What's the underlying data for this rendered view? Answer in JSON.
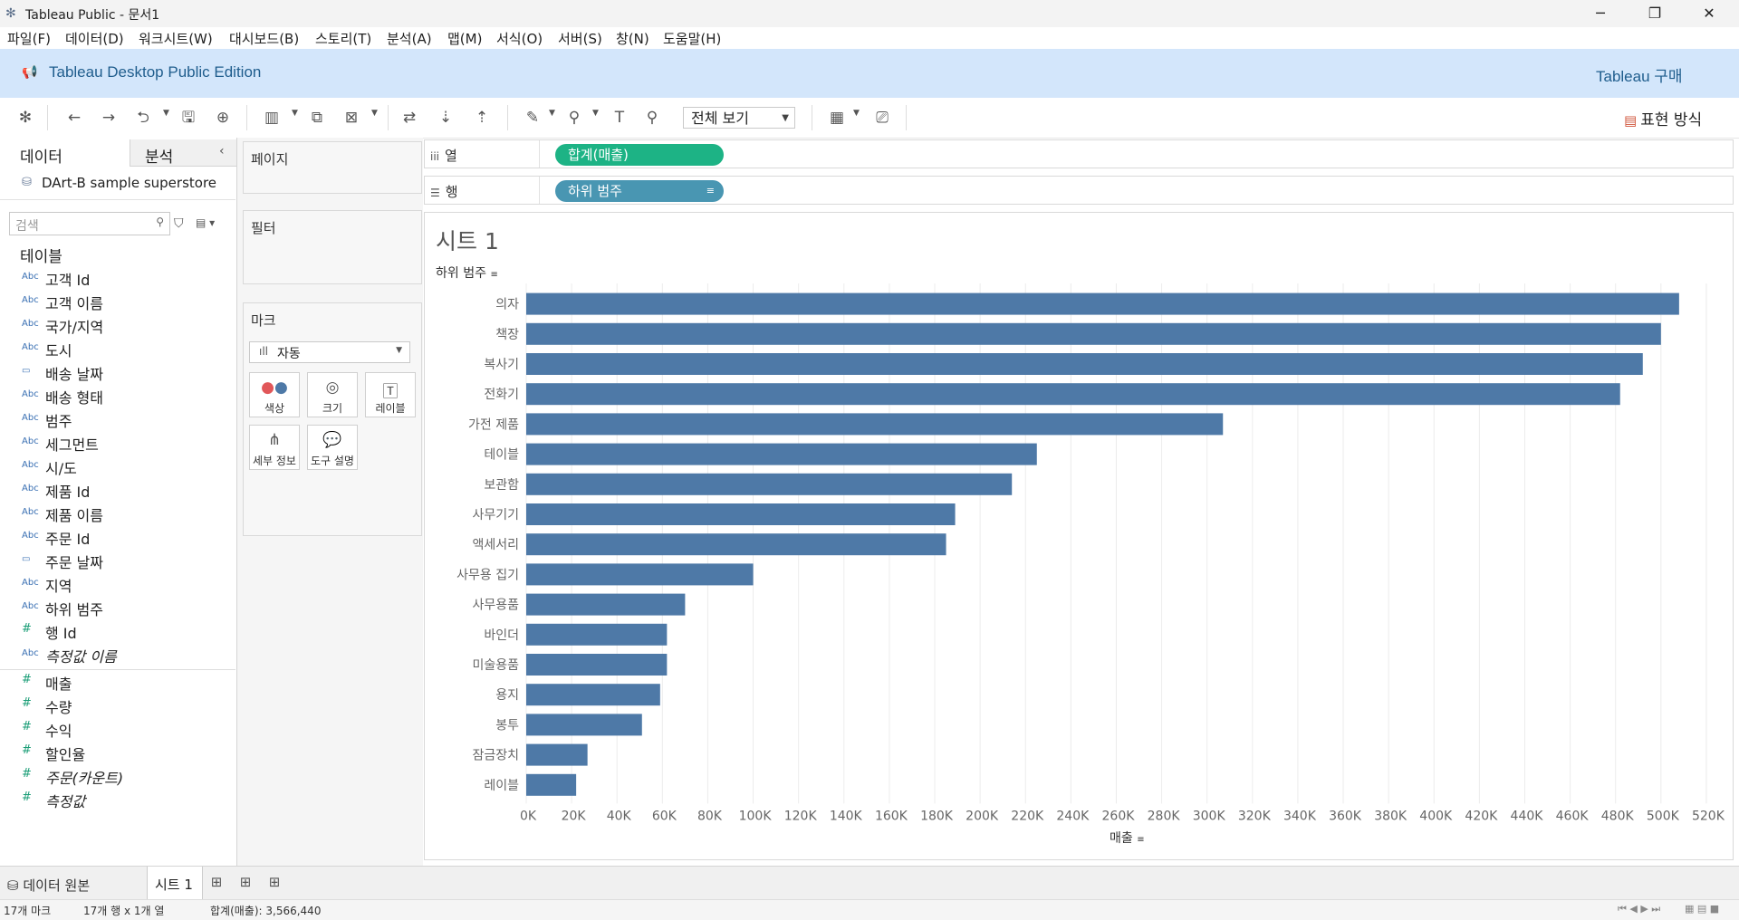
{
  "window": {
    "title": "Tableau Public - 문서1",
    "minimize": "─",
    "restore": "❐",
    "close": "✕"
  },
  "menu": [
    "파일(F)",
    "데이터(D)",
    "워크시트(W)",
    "대시보드(B)",
    "스토리(T)",
    "분석(A)",
    "맵(M)",
    "서식(O)",
    "서버(S)",
    "창(N)",
    "도움말(H)"
  ],
  "edition": {
    "name": "Tableau Desktop Public Edition",
    "buy": "Tableau 구매"
  },
  "toolbar": {
    "fit": "전체 보기",
    "show_me": "표현 방식"
  },
  "data_pane": {
    "tab_data": "데이터",
    "tab_analysis": "분석",
    "datasource": "DArt-B sample superstore",
    "search_placeholder": "검색",
    "tables_heading": "테이블",
    "dimensions": [
      {
        "type": "Abc",
        "name": "고객 Id"
      },
      {
        "type": "Abc",
        "name": "고객 이름"
      },
      {
        "type": "Abc",
        "name": "국가/지역"
      },
      {
        "type": "Abc",
        "name": "도시"
      },
      {
        "type": "date",
        "name": "배송 날짜"
      },
      {
        "type": "Abc",
        "name": "배송 형태"
      },
      {
        "type": "Abc",
        "name": "범주"
      },
      {
        "type": "Abc",
        "name": "세그먼트"
      },
      {
        "type": "Abc",
        "name": "시/도"
      },
      {
        "type": "Abc",
        "name": "제품 Id"
      },
      {
        "type": "Abc",
        "name": "제품 이름"
      },
      {
        "type": "Abc",
        "name": "주문 Id"
      },
      {
        "type": "date",
        "name": "주문 날짜"
      },
      {
        "type": "Abc",
        "name": "지역"
      },
      {
        "type": "Abc",
        "name": "하위 범주"
      },
      {
        "type": "#",
        "name": "행 Id"
      },
      {
        "type": "Abc",
        "name": "측정값 이름",
        "italic": true
      }
    ],
    "measures": [
      {
        "type": "#",
        "name": "매출"
      },
      {
        "type": "#",
        "name": "수량"
      },
      {
        "type": "#",
        "name": "수익"
      },
      {
        "type": "#",
        "name": "할인율"
      },
      {
        "type": "#",
        "name": "주문(카운트)",
        "italic": true
      },
      {
        "type": "#",
        "name": "측정값",
        "italic": true
      }
    ]
  },
  "cards": {
    "pages": "페이지",
    "filters": "필터",
    "marks": "마크",
    "marks_type": "자동",
    "buttons": [
      {
        "icon": "color",
        "label": "색상"
      },
      {
        "icon": "size",
        "label": "크기"
      },
      {
        "icon": "label",
        "label": "레이블"
      },
      {
        "icon": "detail",
        "label": "세부 정보"
      },
      {
        "icon": "tooltip",
        "label": "도구 설명"
      }
    ]
  },
  "shelves": {
    "columns_label": "열",
    "rows_label": "행",
    "columns_pill": "합계(매출)",
    "rows_pill": "하위 범주"
  },
  "sheet": {
    "title": "시트 1",
    "row_header": "하위 범주",
    "x_axis_title": "매출"
  },
  "chart_data": {
    "type": "bar",
    "orientation": "horizontal",
    "categories": [
      "의자",
      "책장",
      "복사기",
      "전화기",
      "가전 제품",
      "테이블",
      "보관함",
      "사무기기",
      "액세서리",
      "사무용 집기",
      "사무용품",
      "바인더",
      "미술용품",
      "용지",
      "봉투",
      "잠금장치",
      "레이블"
    ],
    "values": [
      508000,
      500000,
      492000,
      482000,
      307000,
      225000,
      214000,
      189000,
      185000,
      100000,
      70000,
      62000,
      62000,
      59000,
      51000,
      27000,
      22000
    ],
    "xlabel": "매출",
    "ylabel": "하위 범주",
    "xlim": [
      0,
      530000
    ],
    "x_ticks": [
      "0K",
      "20K",
      "40K",
      "60K",
      "80K",
      "100K",
      "120K",
      "140K",
      "160K",
      "180K",
      "200K",
      "220K",
      "240K",
      "260K",
      "280K",
      "300K",
      "320K",
      "340K",
      "360K",
      "380K",
      "400K",
      "420K",
      "440K",
      "460K",
      "480K",
      "500K",
      "520K"
    ],
    "color": "#4e79a7",
    "grid": "vertical"
  },
  "bottom": {
    "datasource_tab": "데이터 원본",
    "sheet_tab": "시트 1"
  },
  "status": {
    "marks": "17개 마크",
    "dims": "17개 행 x 1개 열",
    "sum": "합계(매출): 3,566,440"
  }
}
